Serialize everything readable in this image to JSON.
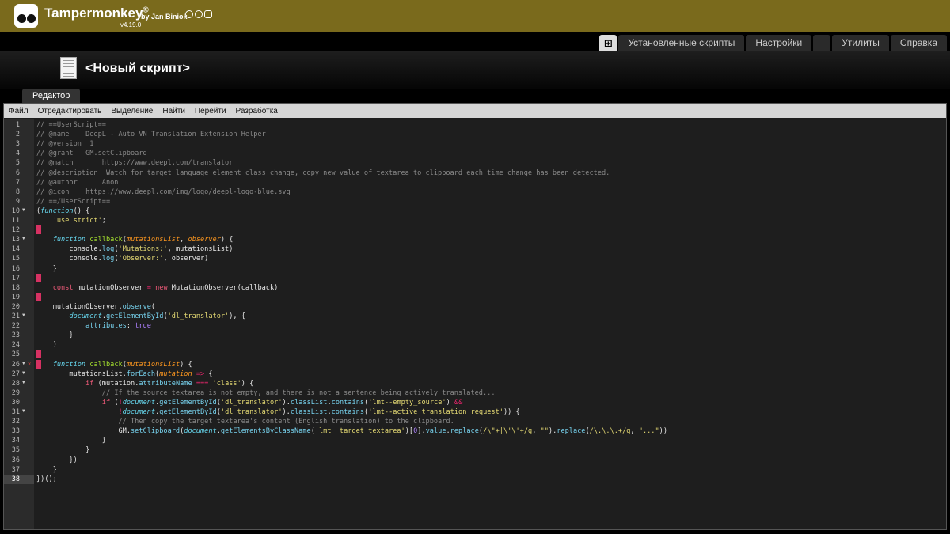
{
  "brand": {
    "name": "Tampermonkey",
    "sup": "®",
    "by": "by Jan Biniok",
    "version": "v4.19.0"
  },
  "nav": {
    "items": [
      "⊞",
      "Установленные скрипты",
      "Настройки",
      "",
      "Утилиты",
      "Справка"
    ]
  },
  "script": {
    "title": "<Новый скрипт>"
  },
  "editor_tab": "Редактор",
  "menu": {
    "items": [
      "Файл",
      "Отредактировать",
      "Выделение",
      "Найти",
      "Перейти",
      "Разработка"
    ]
  },
  "code": {
    "active_line": 38,
    "fold_lines": [
      10,
      13,
      21,
      26,
      27,
      28,
      31
    ],
    "error_lines": [
      26
    ],
    "marker_lines": [
      12,
      17,
      19,
      25,
      26
    ],
    "lines": [
      [
        [
          "c",
          "// ==UserScript=="
        ]
      ],
      [
        [
          "c",
          "// @name    DeepL - Auto VN Translation Extension Helper"
        ]
      ],
      [
        [
          "c",
          "// @version  1"
        ]
      ],
      [
        [
          "c",
          "// @grant   GM.setClipboard"
        ]
      ],
      [
        [
          "c",
          "// @match       https://www.deepl.com/translator"
        ]
      ],
      [
        [
          "c",
          "// @description  Watch for target language element class change, copy new value of textarea to clipboard each time change has been detected."
        ]
      ],
      [
        [
          "c",
          "// @author      Anon"
        ]
      ],
      [
        [
          "c",
          "// @icon    https://www.deepl.com/img/logo/deepl-logo-blue.svg"
        ]
      ],
      [
        [
          "c",
          "// ==/UserScript=="
        ]
      ],
      [
        [
          "p",
          "("
        ],
        [
          "fk",
          "function"
        ],
        [
          "p",
          "() {"
        ]
      ],
      [
        [
          "p",
          "    "
        ],
        [
          "s",
          "'use strict'"
        ],
        [
          "p",
          ";"
        ]
      ],
      [
        [
          "p",
          ""
        ]
      ],
      [
        [
          "p",
          "    "
        ],
        [
          "fk",
          "function"
        ],
        [
          "p",
          " "
        ],
        [
          "fn",
          "callback"
        ],
        [
          "p",
          "("
        ],
        [
          "pa",
          "mutationsList"
        ],
        [
          "p",
          ", "
        ],
        [
          "pa",
          "observer"
        ],
        [
          "p",
          ") {"
        ]
      ],
      [
        [
          "p",
          "        console."
        ],
        [
          "pr",
          "log"
        ],
        [
          "p",
          "("
        ],
        [
          "s",
          "'Mutations:'"
        ],
        [
          "p",
          ", mutationsList)"
        ]
      ],
      [
        [
          "p",
          "        console."
        ],
        [
          "pr",
          "log"
        ],
        [
          "p",
          "("
        ],
        [
          "s",
          "'Observer:'"
        ],
        [
          "p",
          ", observer)"
        ]
      ],
      [
        [
          "p",
          "    }"
        ]
      ],
      [
        [
          "p",
          ""
        ]
      ],
      [
        [
          "p",
          "    "
        ],
        [
          "k",
          "const"
        ],
        [
          "p",
          " mutationObserver "
        ],
        [
          "o",
          "="
        ],
        [
          "p",
          " "
        ],
        [
          "k",
          "new"
        ],
        [
          "p",
          " MutationObserver(callback)"
        ]
      ],
      [
        [
          "p",
          ""
        ]
      ],
      [
        [
          "p",
          "    mutationObserver."
        ],
        [
          "pr",
          "observe"
        ],
        [
          "p",
          "("
        ]
      ],
      [
        [
          "p",
          "        "
        ],
        [
          "g",
          "document"
        ],
        [
          "p",
          "."
        ],
        [
          "pr",
          "getElementById"
        ],
        [
          "p",
          "("
        ],
        [
          "s",
          "'dl_translator'"
        ],
        [
          "p",
          "), {"
        ]
      ],
      [
        [
          "p",
          "            "
        ],
        [
          "pr",
          "attributes"
        ],
        [
          "p",
          ": "
        ],
        [
          "b",
          "true"
        ]
      ],
      [
        [
          "p",
          "        }"
        ]
      ],
      [
        [
          "p",
          "    )"
        ]
      ],
      [
        [
          "p",
          ""
        ]
      ],
      [
        [
          "p",
          "    "
        ],
        [
          "fk",
          "function"
        ],
        [
          "p",
          " "
        ],
        [
          "fn",
          "callback"
        ],
        [
          "p",
          "("
        ],
        [
          "pa",
          "mutationsList"
        ],
        [
          "p",
          ") {"
        ]
      ],
      [
        [
          "p",
          "        mutationsList."
        ],
        [
          "pr",
          "forEach"
        ],
        [
          "p",
          "("
        ],
        [
          "pa",
          "mutation"
        ],
        [
          "p",
          " "
        ],
        [
          "o",
          "=>"
        ],
        [
          "p",
          " {"
        ]
      ],
      [
        [
          "p",
          "            "
        ],
        [
          "k",
          "if"
        ],
        [
          "p",
          " (mutation."
        ],
        [
          "pr",
          "attributeName"
        ],
        [
          "p",
          " "
        ],
        [
          "o",
          "==="
        ],
        [
          "p",
          " "
        ],
        [
          "s",
          "'class'"
        ],
        [
          "p",
          ") {"
        ]
      ],
      [
        [
          "p",
          "                "
        ],
        [
          "c",
          "// If the source textarea is not empty, and there is not a sentence being actively translated..."
        ]
      ],
      [
        [
          "p",
          "                "
        ],
        [
          "k",
          "if"
        ],
        [
          "p",
          " ("
        ],
        [
          "o",
          "!"
        ],
        [
          "g",
          "document"
        ],
        [
          "p",
          "."
        ],
        [
          "pr",
          "getElementById"
        ],
        [
          "p",
          "("
        ],
        [
          "s",
          "'dl_translator'"
        ],
        [
          "p",
          ")."
        ],
        [
          "pr",
          "classList"
        ],
        [
          "p",
          "."
        ],
        [
          "pr",
          "contains"
        ],
        [
          "p",
          "("
        ],
        [
          "s",
          "'lmt--empty_source'"
        ],
        [
          "p",
          ") "
        ],
        [
          "o",
          "&&"
        ]
      ],
      [
        [
          "p",
          "                    "
        ],
        [
          "o",
          "!"
        ],
        [
          "g",
          "document"
        ],
        [
          "p",
          "."
        ],
        [
          "pr",
          "getElementById"
        ],
        [
          "p",
          "("
        ],
        [
          "s",
          "'dl_translator'"
        ],
        [
          "p",
          ")."
        ],
        [
          "pr",
          "classList"
        ],
        [
          "p",
          "."
        ],
        [
          "pr",
          "contains"
        ],
        [
          "p",
          "("
        ],
        [
          "s",
          "'lmt--active_translation_request'"
        ],
        [
          "p",
          ")) {"
        ]
      ],
      [
        [
          "p",
          "                    "
        ],
        [
          "c",
          "// Then copy the target textarea's content (English translation) to the clipboard."
        ]
      ],
      [
        [
          "p",
          "                    GM."
        ],
        [
          "pr",
          "setClipboard"
        ],
        [
          "p",
          "("
        ],
        [
          "g",
          "document"
        ],
        [
          "p",
          "."
        ],
        [
          "pr",
          "getElementsByClassName"
        ],
        [
          "p",
          "("
        ],
        [
          "s",
          "'lmt__target_textarea'"
        ],
        [
          "p",
          ")["
        ],
        [
          "n",
          "0"
        ],
        [
          "p",
          "]."
        ],
        [
          "pr",
          "value"
        ],
        [
          "p",
          "."
        ],
        [
          "pr",
          "replace"
        ],
        [
          "p",
          "("
        ],
        [
          "s",
          "/\\\"+|\\'\\'+/g"
        ],
        [
          "p",
          ", "
        ],
        [
          "s",
          "\"\""
        ],
        [
          "p",
          ")."
        ],
        [
          "pr",
          "replace"
        ],
        [
          "p",
          "("
        ],
        [
          "s",
          "/\\.\\.\\.+/g"
        ],
        [
          "p",
          ", "
        ],
        [
          "s",
          "\"...\""
        ],
        [
          "p",
          "))"
        ]
      ],
      [
        [
          "p",
          "                }"
        ]
      ],
      [
        [
          "p",
          "            }"
        ]
      ],
      [
        [
          "p",
          "        })"
        ]
      ],
      [
        [
          "p",
          "    }"
        ]
      ],
      [
        [
          "p",
          "})();"
        ]
      ]
    ]
  }
}
